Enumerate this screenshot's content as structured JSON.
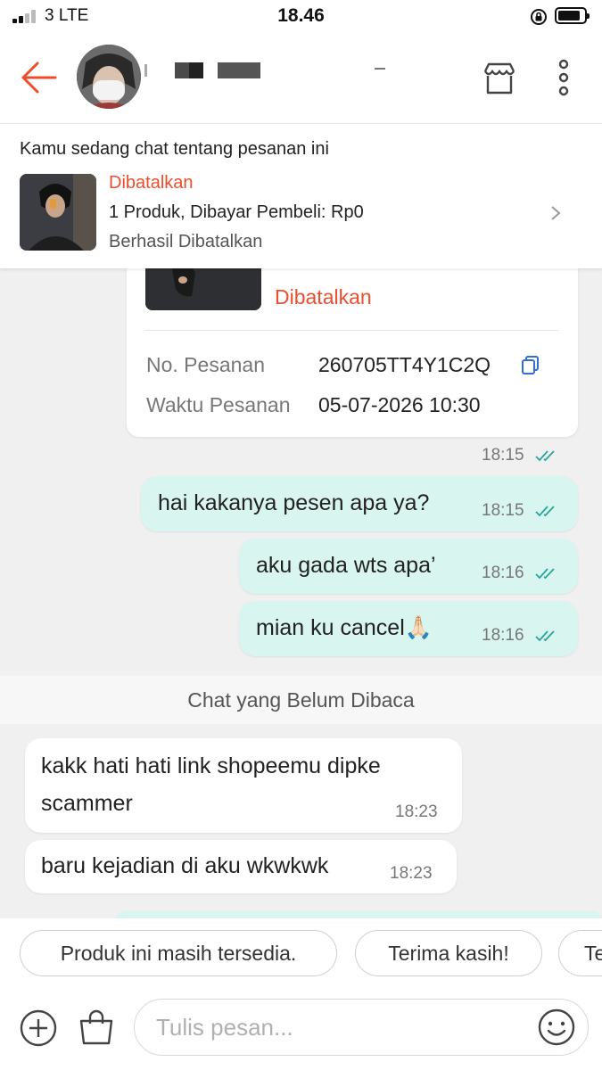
{
  "status_bar": {
    "carrier": "3  LTE",
    "time": "18.46",
    "signal_bars": 2,
    "battery_level": 0.85
  },
  "header": {
    "back_icon": "arrow-left-icon",
    "shop_icon": "shop-icon",
    "more_icon": "more-vertical-icon",
    "accent_color": "#ee4d2d"
  },
  "order_banner": {
    "title": "Kamu sedang chat tentang pesanan ini",
    "status": "Dibatalkan",
    "summary": "1 Produk, Dibayar Pembeli: Rp0",
    "substatus": "Berhasil Dibatalkan"
  },
  "order_card": {
    "status": "Dibatalkan",
    "order_no_label": "No. Pesanan",
    "order_no": "260705TT4Y1C2Q",
    "order_time_label": "Waktu Pesanan",
    "order_time": "05-07-2026 10:30",
    "time": "18:15"
  },
  "messages": [
    {
      "text": "hai kakanya pesen apa ya?",
      "time": "18:15",
      "direction": "out"
    },
    {
      "text": "aku gada wts apa’",
      "time": "18:16",
      "direction": "out"
    },
    {
      "text": "mian ku cancel🙏🏻",
      "time": "18:16",
      "direction": "out"
    }
  ],
  "unread_label": "Chat yang Belum Dibaca",
  "incoming": [
    {
      "text_line1": "kakk hati hati link shopeemu dipke",
      "text_line2": "scammer",
      "time": "18:23"
    },
    {
      "text": "baru kejadian di aku wkwkwk",
      "time": "18:23"
    }
  ],
  "quick_replies": [
    "Produk ini masih tersedia.",
    "Terima kasih!",
    "Te"
  ],
  "composer": {
    "placeholder": "Tulis pesan...",
    "add_icon": "plus-circle-icon",
    "product_icon": "shopping-bag-icon",
    "emoji_icon": "emoji-icon"
  },
  "colors": {
    "accent": "#ee4d2d",
    "outgoing_bubble": "#d8f5ef",
    "read_ticks": "#26a69a"
  }
}
